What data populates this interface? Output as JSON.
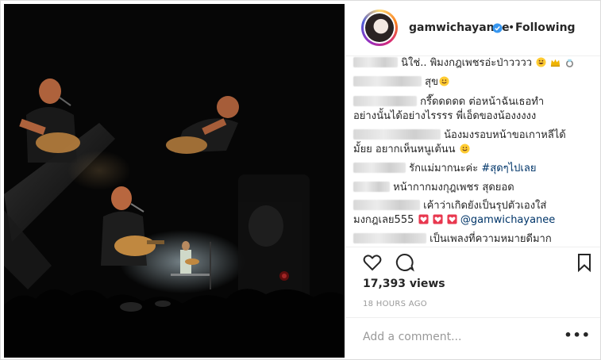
{
  "header": {
    "username": "gamwichayanee",
    "separator": "•",
    "follow_status": "Following"
  },
  "comments": [
    {
      "text": "นิใช่.. พิมงกฎเพชรอ่ะป่าวววว",
      "emojis": [
        "grinning-emoji",
        "crown-emoji",
        "ring-emoji"
      ]
    },
    {
      "text": "สุข",
      "emojis": [
        "smiling-emoji"
      ]
    },
    {
      "text": "กรี๊ดดดดด ต่อหน้าฉันเธอทำ",
      "text2": "อย่างนั้นได้อย่างไรรรร พี่เอ็ดของน้องงงงง"
    },
    {
      "text": "น้องมงรอบหน้าขอเกาหลีได้",
      "text2": "มั้ยย อยากเห็นหนูเต้นน",
      "emojis2": [
        "smiling-emoji"
      ]
    },
    {
      "text": "รักแม่มากนะค่ะ",
      "tag": "#สุดๆไปเลย"
    },
    {
      "text": "หน้ากากมงกุฎเพชร สุดยอด"
    },
    {
      "text": "เค้าว่าเกิดยังเป็นรุปตัวเองใส่",
      "text2": "มงกฎเลย555",
      "emojis2": [
        "heart-emoji",
        "heart-emoji",
        "heart-emoji"
      ],
      "mention": "@gamwichayanee"
    },
    {
      "text": "เป็นเพลงที่ความหมายดีมาก"
    }
  ],
  "stats": {
    "views": "17,393 views",
    "time": "18 HOURS AGO"
  },
  "add_comment": {
    "placeholder": "Add a comment...",
    "more": "•••"
  },
  "colors": {
    "text": "#262626",
    "muted": "#999999",
    "border": "#efefef",
    "verified": "#3897f0",
    "mention": "#003569"
  }
}
